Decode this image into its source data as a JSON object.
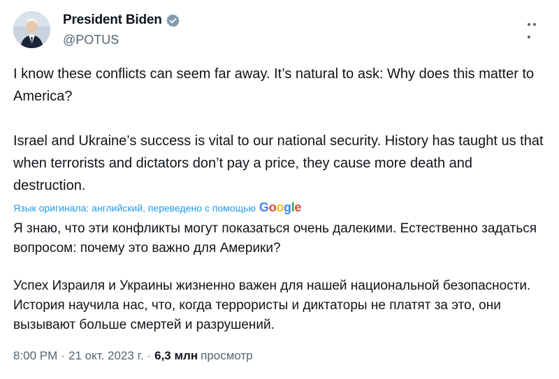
{
  "author": {
    "name": "President Biden",
    "handle": "@POTUS"
  },
  "tweet": {
    "paragraphs": [
      "I know these conflicts can seem far away. It’s natural to ask: Why does this matter to America?",
      "Israel and Ukraine’s success is vital to our national security. History has taught us that when terrorists and dictators don’t pay a price, they cause more death and destruction."
    ],
    "translation_note": "Язык оригинала: английский, переведено с помощью",
    "translation_provider": "Google",
    "translated_paragraphs": [
      "Я знаю, что эти конфликты могут показаться очень далекими. Естественно задаться вопросом: почему это важно для Америки?",
      "Успех Израиля и Украины жизненно важен для нашей национальной безопасности. История научила нас, что, когда террористы и диктаторы не платят за это, они вызывают больше смертей и разрушений."
    ]
  },
  "meta": {
    "time": "8:00 PM",
    "separator": "·",
    "date": "21 окт. 2023 г.",
    "views_count": "6,3 млн",
    "views_label": "просмотр"
  },
  "icons": {
    "avatar": "avatar-photo",
    "verified": "verified-badge-icon",
    "more": "more-options-icon"
  },
  "colors": {
    "verified_badge": "#829aab",
    "link": "#1d9bf0",
    "secondary_text": "#536471"
  }
}
